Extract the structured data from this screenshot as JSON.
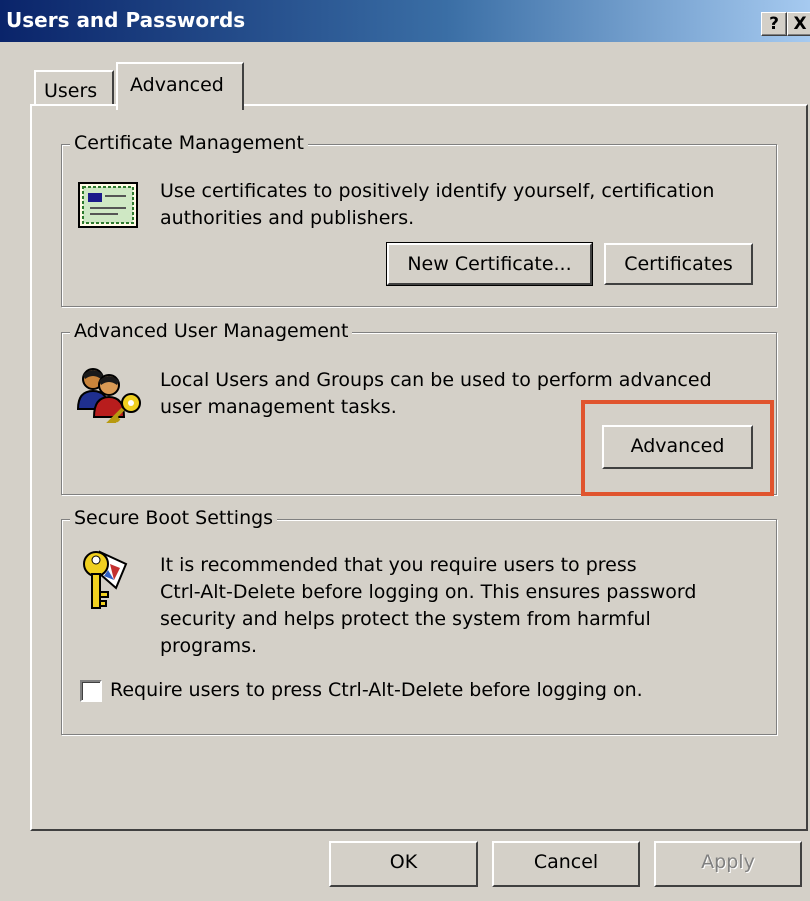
{
  "window": {
    "title": "Users and Passwords",
    "help_label": "?",
    "close_label": "X"
  },
  "tabs": [
    {
      "label": "Users",
      "selected": false
    },
    {
      "label": "Advanced",
      "selected": true
    }
  ],
  "certificate_management": {
    "legend": "Certificate Management",
    "description_line1": "Use certificates to positively identify yourself, certification",
    "description_line2": "authorities and publishers.",
    "new_certificate_label": "New Certificate...",
    "certificates_label": "Certificates",
    "icon": "certificate-icon"
  },
  "advanced_user_management": {
    "legend": "Advanced User Management",
    "description_line1": "Local Users and Groups can be used to perform advanced",
    "description_line2": "user management tasks.",
    "advanced_label": "Advanced",
    "icon": "users-key-icon"
  },
  "secure_boot": {
    "legend": "Secure Boot Settings",
    "description_line1": "It is recommended that you require users to press",
    "description_line2": "Ctrl-Alt-Delete before logging on. This ensures password",
    "description_line3": "security and helps protect the system from harmful",
    "description_line4": "programs.",
    "checkbox_label": "Require users to press Ctrl-Alt-Delete before logging on.",
    "checkbox_checked": false,
    "icon": "key-icon"
  },
  "footer": {
    "ok_label": "OK",
    "cancel_label": "Cancel",
    "apply_label": "Apply",
    "apply_enabled": false
  },
  "highlight_color": "#e0542e"
}
